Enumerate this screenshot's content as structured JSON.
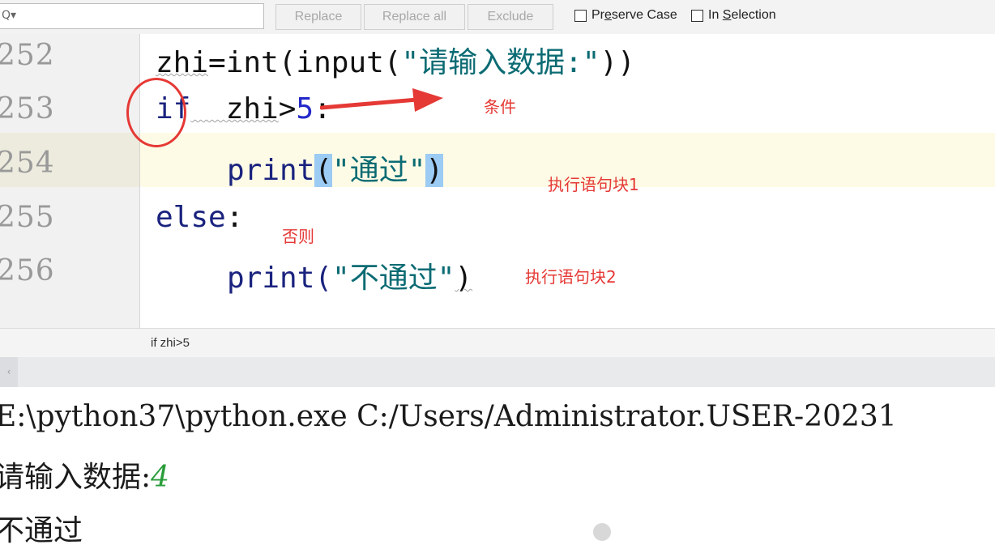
{
  "find_bar": {
    "search_value": "",
    "replace_label": "Replace",
    "replace_all_label": "Replace all",
    "exclude_label": "Exclude",
    "preserve_case": {
      "pre": "Pr",
      "mnemonic": "e",
      "post": "serve Case"
    },
    "in_selection": {
      "pre": "In ",
      "mnemonic": "S",
      "post": "election"
    }
  },
  "gutter": {
    "lines": [
      "252",
      "253",
      "254",
      "255",
      "256"
    ]
  },
  "code": {
    "l252": {
      "a": "zhi",
      "b": "=int(input(",
      "c": "\"请输入数据:\"",
      "d": "))"
    },
    "l253": {
      "kw": "if",
      "a": "  zhi",
      "b": ">",
      "num": "5",
      "c": ":"
    },
    "l254": {
      "a": "print",
      "p1": "(",
      "str": "\"通过\"",
      "p2": ")"
    },
    "l255": {
      "kw": "else",
      "c": ":"
    },
    "l256": {
      "a": "print(",
      "str": "\"不通过\"",
      "b": ")"
    }
  },
  "annotations": {
    "condition": "条件",
    "block1": "执行语句块1",
    "else": "否则",
    "block2": "执行语句块2"
  },
  "breadcrumb": "if zhi>5",
  "console": {
    "command": "E:\\python37\\python.exe C:/Users/Administrator.USER-20231",
    "prompt": "请输入数据:",
    "input_value": "4",
    "output": "不通过"
  },
  "colors": {
    "annotation": "#e53935",
    "keyword": "#1a237e",
    "string": "#0b6b73",
    "number": "#2329c9",
    "input_value": "#2a9d3a",
    "current_line": "#fdfbe6",
    "bracket_match": "#9ccbf3"
  }
}
